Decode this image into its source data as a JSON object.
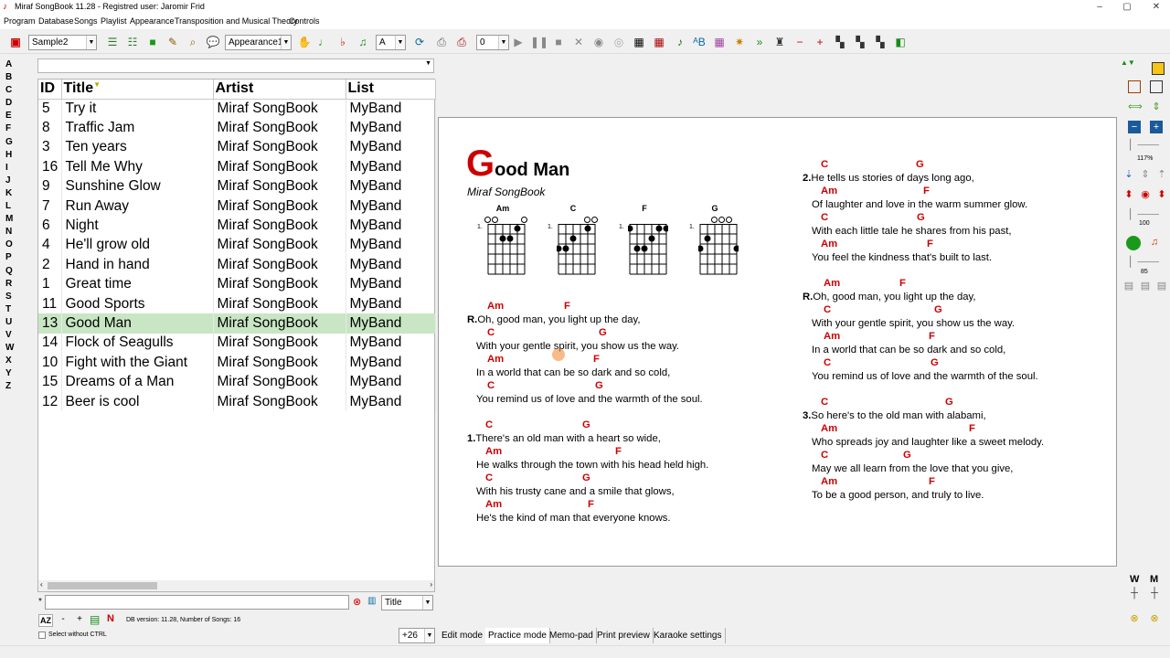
{
  "window": {
    "title": "Miraf SongBook 11.28 - Registred user: Jaromir Frid",
    "minimize": "–",
    "maximize": "▢",
    "close": "✕"
  },
  "menu": [
    "Program",
    "Database",
    "Songs",
    "Playlist",
    "Appearance",
    "Transposition and Musical Theory",
    "Controls"
  ],
  "toolbar": {
    "songbook_select": "Sample2",
    "appearance_select": "Appearance1",
    "font_select": "A",
    "transpose_value": "0"
  },
  "letters": [
    "A",
    "B",
    "C",
    "D",
    "E",
    "F",
    "G",
    "H",
    "I",
    "J",
    "K",
    "L",
    "M",
    "N",
    "O",
    "P",
    "Q",
    "R",
    "S",
    "T",
    "U",
    "V",
    "W",
    "X",
    "Y",
    "Z"
  ],
  "table": {
    "headers": {
      "id": "ID",
      "title": "Title",
      "artist": "Artist",
      "list": "List"
    },
    "rows": [
      {
        "id": "5",
        "title": "Try it",
        "artist": "Miraf SongBook",
        "list": "MyBand"
      },
      {
        "id": "8",
        "title": "Traffic Jam",
        "artist": "Miraf SongBook",
        "list": "MyBand"
      },
      {
        "id": "3",
        "title": "Ten years",
        "artist": "Miraf SongBook",
        "list": "MyBand"
      },
      {
        "id": "16",
        "title": "Tell Me Why",
        "artist": "Miraf SongBook",
        "list": "MyBand"
      },
      {
        "id": "9",
        "title": "Sunshine Glow",
        "artist": "Miraf SongBook",
        "list": "MyBand"
      },
      {
        "id": "7",
        "title": "Run Away",
        "artist": "Miraf SongBook",
        "list": "MyBand"
      },
      {
        "id": "6",
        "title": "Night",
        "artist": "Miraf SongBook",
        "list": "MyBand"
      },
      {
        "id": "4",
        "title": "He'll grow old",
        "artist": "Miraf SongBook",
        "list": "MyBand"
      },
      {
        "id": "2",
        "title": "Hand in hand",
        "artist": "Miraf SongBook",
        "list": "MyBand"
      },
      {
        "id": "1",
        "title": "Great time",
        "artist": "Miraf SongBook",
        "list": "MyBand"
      },
      {
        "id": "11",
        "title": "Good Sports",
        "artist": "Miraf SongBook",
        "list": "MyBand"
      },
      {
        "id": "13",
        "title": "Good Man",
        "artist": "Miraf SongBook",
        "list": "MyBand",
        "selected": true
      },
      {
        "id": "14",
        "title": "Flock of Seagulls",
        "artist": "Miraf SongBook",
        "list": "MyBand"
      },
      {
        "id": "10",
        "title": "Fight with the Giant",
        "artist": "Miraf SongBook",
        "list": "MyBand"
      },
      {
        "id": "15",
        "title": "Dreams of a Man",
        "artist": "Miraf SongBook",
        "list": "MyBand"
      },
      {
        "id": "12",
        "title": "Beer is cool",
        "artist": "Miraf SongBook",
        "list": "MyBand"
      }
    ]
  },
  "bottom_left": {
    "search_prefix": "*",
    "search_field_select": "Title",
    "db_info": "DB version: 11.28, Number of Songs: 16",
    "select_without_ctrl": "Select without CTRL",
    "offset": "+26",
    "sort_az": "AZ",
    "minus": "-",
    "plus": "+"
  },
  "song": {
    "title_initial": "G",
    "title_rest": "ood Man",
    "artist": "Miraf SongBook",
    "chords": [
      {
        "name": "Am",
        "fret": "1."
      },
      {
        "name": "C",
        "fret": "1."
      },
      {
        "name": "F",
        "fret": "1."
      },
      {
        "name": "G",
        "fret": "1."
      }
    ],
    "left_column": [
      {
        "chords": [
          {
            "t": "Am",
            "o": 12
          },
          {
            "t": "F",
            "o": 96
          }
        ],
        "label": "R.",
        "text": "Oh, good man, you light up the day,"
      },
      {
        "chords": [
          {
            "t": "C",
            "o": 12
          },
          {
            "t": "G",
            "o": 134
          }
        ],
        "label": "",
        "text": "With your gentle spirit, you show us the way."
      },
      {
        "chords": [
          {
            "t": "Am",
            "o": 12
          },
          {
            "t": "F",
            "o": 128
          }
        ],
        "label": "",
        "text": "In a world that can be so dark and so cold,"
      },
      {
        "chords": [
          {
            "t": "C",
            "o": 12
          },
          {
            "t": "G",
            "o": 130
          }
        ],
        "label": "",
        "text": "You remind us of love and the warmth of the soul."
      },
      {
        "chords": [
          {
            "t": "C",
            "o": 10
          },
          {
            "t": "G",
            "o": 116
          }
        ],
        "label": "1.",
        "text": "There's an old man with a heart so wide,"
      },
      {
        "chords": [
          {
            "t": "Am",
            "o": 10
          },
          {
            "t": "F",
            "o": 152
          }
        ],
        "label": "",
        "text": "He walks through the town with his head held high."
      },
      {
        "chords": [
          {
            "t": "C",
            "o": 10
          },
          {
            "t": "G",
            "o": 116
          }
        ],
        "label": "",
        "text": "With his trusty cane and a smile that glows,"
      },
      {
        "chords": [
          {
            "t": "Am",
            "o": 10
          },
          {
            "t": "F",
            "o": 122
          }
        ],
        "label": "",
        "text": "He's the kind of man that everyone knows."
      }
    ],
    "right_column": [
      {
        "chords": [
          {
            "t": "C",
            "o": 10
          },
          {
            "t": "G",
            "o": 114
          }
        ],
        "label": "2.",
        "text": "He tells us stories of days long ago,"
      },
      {
        "chords": [
          {
            "t": "Am",
            "o": 10
          },
          {
            "t": "F",
            "o": 122
          }
        ],
        "label": "",
        "text": "Of laughter and love in the warm summer glow."
      },
      {
        "chords": [
          {
            "t": "C",
            "o": 10
          },
          {
            "t": "G",
            "o": 115
          }
        ],
        "label": "",
        "text": "With each little tale he shares from his past,"
      },
      {
        "chords": [
          {
            "t": "Am",
            "o": 10
          },
          {
            "t": "F",
            "o": 126
          }
        ],
        "label": "",
        "text": "You feel the kindness that's built to last."
      },
      {
        "chords": [
          {
            "t": "Am",
            "o": 13
          },
          {
            "t": "F",
            "o": 96
          }
        ],
        "label": "R.",
        "text": "Oh, good man, you light up the day,"
      },
      {
        "chords": [
          {
            "t": "C",
            "o": 13
          },
          {
            "t": "G",
            "o": 134
          }
        ],
        "label": "",
        "text": "With your gentle spirit, you show us the way."
      },
      {
        "chords": [
          {
            "t": "Am",
            "o": 13
          },
          {
            "t": "F",
            "o": 128
          }
        ],
        "label": "",
        "text": "In a world that can be so dark and so cold,"
      },
      {
        "chords": [
          {
            "t": "C",
            "o": 13
          },
          {
            "t": "G",
            "o": 130
          }
        ],
        "label": "",
        "text": "You remind us of love and the warmth of the soul."
      },
      {
        "chords": [
          {
            "t": "C",
            "o": 10
          },
          {
            "t": "G",
            "o": 146
          }
        ],
        "label": "3.",
        "text": "So here's to the old man with alabami,"
      },
      {
        "chords": [
          {
            "t": "Am",
            "o": 10
          },
          {
            "t": "F",
            "o": 172
          }
        ],
        "label": "",
        "text": "Who spreads joy and laughter like a sweet melody."
      },
      {
        "chords": [
          {
            "t": "C",
            "o": 10
          },
          {
            "t": "G",
            "o": 100
          }
        ],
        "label": "",
        "text": "May we all learn from the love that you give,"
      },
      {
        "chords": [
          {
            "t": "Am",
            "o": 10
          },
          {
            "t": "F",
            "o": 128
          }
        ],
        "label": "",
        "text": "To be a good person, and truly to live."
      }
    ]
  },
  "right_tools": {
    "zoom": "117%",
    "val1": "100",
    "val2": "85",
    "w_label": "W",
    "m_label": "M"
  },
  "tabs": [
    "Edit mode",
    "Practice mode",
    "Memo-pad",
    "Print preview",
    "Karaoke settings"
  ],
  "colors": {
    "chord": "#cc0000",
    "selected_row": "#c8e6c3",
    "title_initial": "#cc0000"
  }
}
